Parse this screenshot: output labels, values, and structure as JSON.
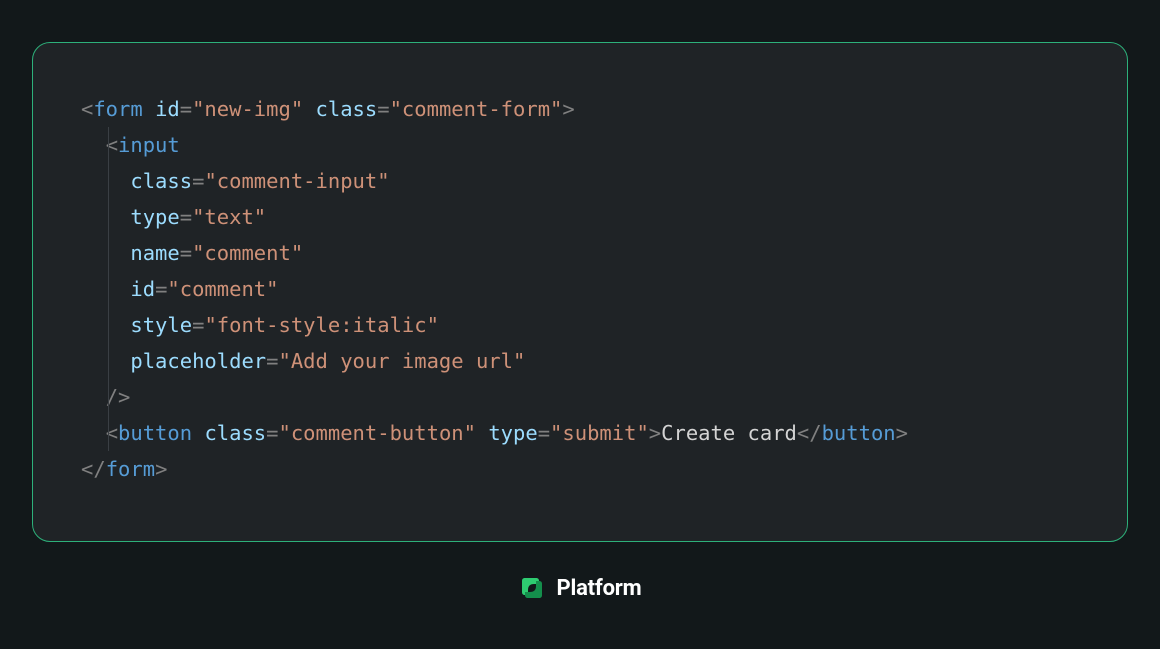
{
  "code": {
    "lines": [
      {
        "indent": 0,
        "parts": [
          {
            "c": "p",
            "t": "<"
          },
          {
            "c": "t",
            "t": "form"
          },
          {
            "c": "p",
            "t": " "
          },
          {
            "c": "a",
            "t": "id"
          },
          {
            "c": "p",
            "t": "="
          },
          {
            "c": "s",
            "t": "\"new-img\""
          },
          {
            "c": "p",
            "t": " "
          },
          {
            "c": "a",
            "t": "class"
          },
          {
            "c": "p",
            "t": "="
          },
          {
            "c": "s",
            "t": "\"comment-form\""
          },
          {
            "c": "p",
            "t": ">"
          }
        ]
      },
      {
        "indent": 1,
        "parts": [
          {
            "c": "p",
            "t": "<"
          },
          {
            "c": "t",
            "t": "input"
          }
        ]
      },
      {
        "indent": 2,
        "parts": [
          {
            "c": "a",
            "t": "class"
          },
          {
            "c": "p",
            "t": "="
          },
          {
            "c": "s",
            "t": "\"comment-input\""
          }
        ]
      },
      {
        "indent": 2,
        "parts": [
          {
            "c": "a",
            "t": "type"
          },
          {
            "c": "p",
            "t": "="
          },
          {
            "c": "s",
            "t": "\"text\""
          }
        ]
      },
      {
        "indent": 2,
        "parts": [
          {
            "c": "a",
            "t": "name"
          },
          {
            "c": "p",
            "t": "="
          },
          {
            "c": "s",
            "t": "\"comment\""
          }
        ]
      },
      {
        "indent": 2,
        "parts": [
          {
            "c": "a",
            "t": "id"
          },
          {
            "c": "p",
            "t": "="
          },
          {
            "c": "s",
            "t": "\"comment\""
          }
        ]
      },
      {
        "indent": 2,
        "parts": [
          {
            "c": "a",
            "t": "style"
          },
          {
            "c": "p",
            "t": "="
          },
          {
            "c": "s",
            "t": "\"font-style:italic\""
          }
        ]
      },
      {
        "indent": 2,
        "parts": [
          {
            "c": "a",
            "t": "placeholder"
          },
          {
            "c": "p",
            "t": "="
          },
          {
            "c": "s",
            "t": "\"Add your image url\""
          }
        ]
      },
      {
        "indent": 1,
        "parts": [
          {
            "c": "p",
            "t": "/>"
          }
        ]
      },
      {
        "indent": 1,
        "parts": [
          {
            "c": "p",
            "t": "<"
          },
          {
            "c": "t",
            "t": "button"
          },
          {
            "c": "p",
            "t": " "
          },
          {
            "c": "a",
            "t": "class"
          },
          {
            "c": "p",
            "t": "="
          },
          {
            "c": "s",
            "t": "\"comment-button\""
          },
          {
            "c": "p",
            "t": " "
          },
          {
            "c": "a",
            "t": "type"
          },
          {
            "c": "p",
            "t": "="
          },
          {
            "c": "s",
            "t": "\"submit\""
          },
          {
            "c": "p",
            "t": ">"
          },
          {
            "c": "tx",
            "t": "Create card"
          },
          {
            "c": "p",
            "t": "</"
          },
          {
            "c": "t",
            "t": "button"
          },
          {
            "c": "p",
            "t": ">"
          }
        ]
      },
      {
        "indent": 0,
        "parts": [
          {
            "c": "p",
            "t": "</"
          },
          {
            "c": "t",
            "t": "form"
          },
          {
            "c": "p",
            "t": ">"
          }
        ]
      }
    ]
  },
  "footer": {
    "label": "Platform"
  }
}
